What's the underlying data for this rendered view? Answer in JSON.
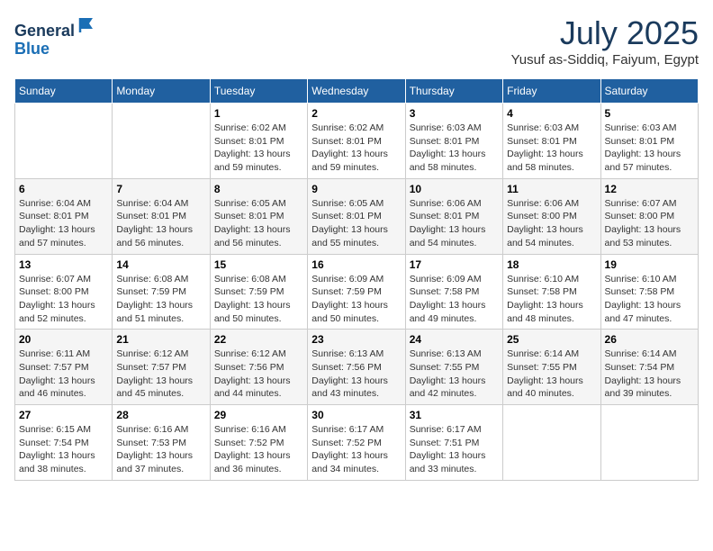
{
  "header": {
    "logo_general": "General",
    "logo_blue": "Blue",
    "month_year": "July 2025",
    "location": "Yusuf as-Siddiq, Faiyum, Egypt"
  },
  "days_of_week": [
    "Sunday",
    "Monday",
    "Tuesday",
    "Wednesday",
    "Thursday",
    "Friday",
    "Saturday"
  ],
  "weeks": [
    [
      {
        "day": "",
        "info": ""
      },
      {
        "day": "",
        "info": ""
      },
      {
        "day": "1",
        "info": "Sunrise: 6:02 AM\nSunset: 8:01 PM\nDaylight: 13 hours and 59 minutes."
      },
      {
        "day": "2",
        "info": "Sunrise: 6:02 AM\nSunset: 8:01 PM\nDaylight: 13 hours and 59 minutes."
      },
      {
        "day": "3",
        "info": "Sunrise: 6:03 AM\nSunset: 8:01 PM\nDaylight: 13 hours and 58 minutes."
      },
      {
        "day": "4",
        "info": "Sunrise: 6:03 AM\nSunset: 8:01 PM\nDaylight: 13 hours and 58 minutes."
      },
      {
        "day": "5",
        "info": "Sunrise: 6:03 AM\nSunset: 8:01 PM\nDaylight: 13 hours and 57 minutes."
      }
    ],
    [
      {
        "day": "6",
        "info": "Sunrise: 6:04 AM\nSunset: 8:01 PM\nDaylight: 13 hours and 57 minutes."
      },
      {
        "day": "7",
        "info": "Sunrise: 6:04 AM\nSunset: 8:01 PM\nDaylight: 13 hours and 56 minutes."
      },
      {
        "day": "8",
        "info": "Sunrise: 6:05 AM\nSunset: 8:01 PM\nDaylight: 13 hours and 56 minutes."
      },
      {
        "day": "9",
        "info": "Sunrise: 6:05 AM\nSunset: 8:01 PM\nDaylight: 13 hours and 55 minutes."
      },
      {
        "day": "10",
        "info": "Sunrise: 6:06 AM\nSunset: 8:01 PM\nDaylight: 13 hours and 54 minutes."
      },
      {
        "day": "11",
        "info": "Sunrise: 6:06 AM\nSunset: 8:00 PM\nDaylight: 13 hours and 54 minutes."
      },
      {
        "day": "12",
        "info": "Sunrise: 6:07 AM\nSunset: 8:00 PM\nDaylight: 13 hours and 53 minutes."
      }
    ],
    [
      {
        "day": "13",
        "info": "Sunrise: 6:07 AM\nSunset: 8:00 PM\nDaylight: 13 hours and 52 minutes."
      },
      {
        "day": "14",
        "info": "Sunrise: 6:08 AM\nSunset: 7:59 PM\nDaylight: 13 hours and 51 minutes."
      },
      {
        "day": "15",
        "info": "Sunrise: 6:08 AM\nSunset: 7:59 PM\nDaylight: 13 hours and 50 minutes."
      },
      {
        "day": "16",
        "info": "Sunrise: 6:09 AM\nSunset: 7:59 PM\nDaylight: 13 hours and 50 minutes."
      },
      {
        "day": "17",
        "info": "Sunrise: 6:09 AM\nSunset: 7:58 PM\nDaylight: 13 hours and 49 minutes."
      },
      {
        "day": "18",
        "info": "Sunrise: 6:10 AM\nSunset: 7:58 PM\nDaylight: 13 hours and 48 minutes."
      },
      {
        "day": "19",
        "info": "Sunrise: 6:10 AM\nSunset: 7:58 PM\nDaylight: 13 hours and 47 minutes."
      }
    ],
    [
      {
        "day": "20",
        "info": "Sunrise: 6:11 AM\nSunset: 7:57 PM\nDaylight: 13 hours and 46 minutes."
      },
      {
        "day": "21",
        "info": "Sunrise: 6:12 AM\nSunset: 7:57 PM\nDaylight: 13 hours and 45 minutes."
      },
      {
        "day": "22",
        "info": "Sunrise: 6:12 AM\nSunset: 7:56 PM\nDaylight: 13 hours and 44 minutes."
      },
      {
        "day": "23",
        "info": "Sunrise: 6:13 AM\nSunset: 7:56 PM\nDaylight: 13 hours and 43 minutes."
      },
      {
        "day": "24",
        "info": "Sunrise: 6:13 AM\nSunset: 7:55 PM\nDaylight: 13 hours and 42 minutes."
      },
      {
        "day": "25",
        "info": "Sunrise: 6:14 AM\nSunset: 7:55 PM\nDaylight: 13 hours and 40 minutes."
      },
      {
        "day": "26",
        "info": "Sunrise: 6:14 AM\nSunset: 7:54 PM\nDaylight: 13 hours and 39 minutes."
      }
    ],
    [
      {
        "day": "27",
        "info": "Sunrise: 6:15 AM\nSunset: 7:54 PM\nDaylight: 13 hours and 38 minutes."
      },
      {
        "day": "28",
        "info": "Sunrise: 6:16 AM\nSunset: 7:53 PM\nDaylight: 13 hours and 37 minutes."
      },
      {
        "day": "29",
        "info": "Sunrise: 6:16 AM\nSunset: 7:52 PM\nDaylight: 13 hours and 36 minutes."
      },
      {
        "day": "30",
        "info": "Sunrise: 6:17 AM\nSunset: 7:52 PM\nDaylight: 13 hours and 34 minutes."
      },
      {
        "day": "31",
        "info": "Sunrise: 6:17 AM\nSunset: 7:51 PM\nDaylight: 13 hours and 33 minutes."
      },
      {
        "day": "",
        "info": ""
      },
      {
        "day": "",
        "info": ""
      }
    ]
  ]
}
